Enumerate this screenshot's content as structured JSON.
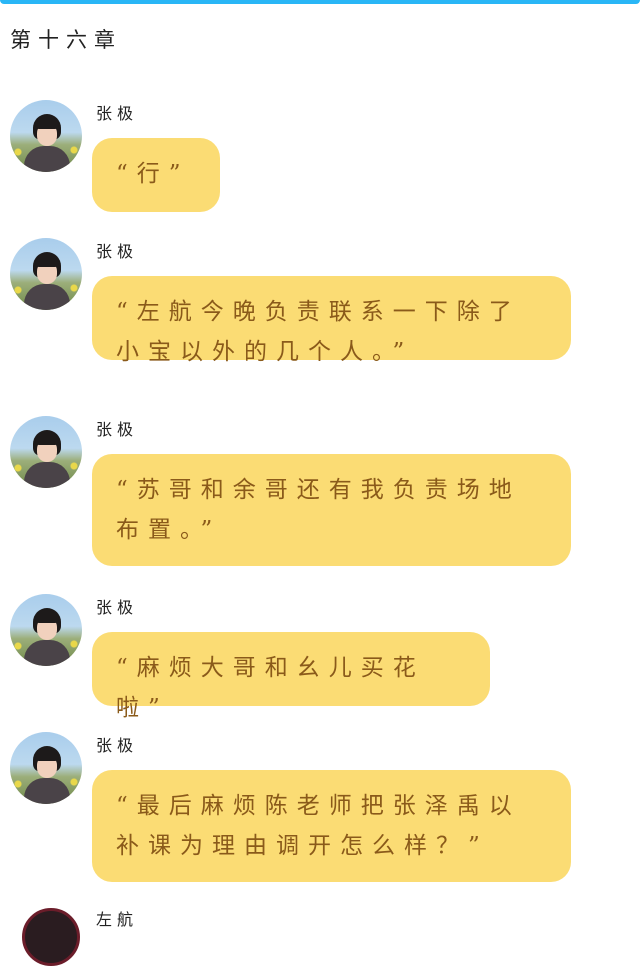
{
  "chapter_title": "第十六章",
  "messages": [
    {
      "sender": "张极",
      "text": "“行”"
    },
    {
      "sender": "张极",
      "text": "“左航今晚负责联系一下除了小宝以外的几个人。”"
    },
    {
      "sender": "张极",
      "text": "“苏哥和余哥还有我负责场地布置。”"
    },
    {
      "sender": "张极",
      "text": "“麻烦大哥和幺儿买花啦”"
    },
    {
      "sender": "张极",
      "text": "“最后麻烦陈老师把张泽禹以补课为理由调开怎么样？”"
    }
  ],
  "next_message": {
    "sender": "左航"
  },
  "colors": {
    "bubble": "#fbdc74",
    "bubble_text": "#8a5a1a",
    "top_bar": "#29b6f6"
  }
}
